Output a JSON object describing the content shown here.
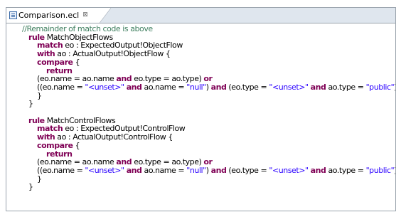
{
  "tab": {
    "label": "Comparison.ecl",
    "close_glyph": "⊠",
    "icon": "ecl-file-icon"
  },
  "colors": {
    "keyword": "#7f0055",
    "comment": "#3f7f5f",
    "string": "#2a00ff",
    "text": "#000000",
    "tab_strip": "#dfe6ee",
    "border": "#9aa3ad"
  },
  "code_lines": [
    [
      {
        "t": "comment",
        "v": "//Remainder of match code is above"
      }
    ],
    [
      {
        "t": "keyword",
        "v": "rule"
      },
      {
        "t": "plain",
        "v": " MatchObjectFlows"
      }
    ],
    [
      {
        "t": "keyword",
        "v": "match"
      },
      {
        "t": "plain",
        "v": " eo : ExpectedOutput!ObjectFlow"
      }
    ],
    [
      {
        "t": "keyword",
        "v": "with"
      },
      {
        "t": "plain",
        "v": " ao : ActualOutput!ObjectFlow {"
      }
    ],
    [
      {
        "t": "keyword",
        "v": "compare"
      },
      {
        "t": "plain",
        "v": " {"
      }
    ],
    [
      {
        "t": "keyword",
        "v": "return"
      }
    ],
    [
      {
        "t": "plain",
        "v": "(eo.name = ao.name "
      },
      {
        "t": "keyword",
        "v": "and"
      },
      {
        "t": "plain",
        "v": " eo.type = ao.type) "
      },
      {
        "t": "keyword",
        "v": "or"
      }
    ],
    [
      {
        "t": "plain",
        "v": "((eo.name = "
      },
      {
        "t": "string",
        "v": "\"<unset>\""
      },
      {
        "t": "plain",
        "v": " "
      },
      {
        "t": "keyword",
        "v": "and"
      },
      {
        "t": "plain",
        "v": " ao.name = "
      },
      {
        "t": "string",
        "v": "\"null\""
      },
      {
        "t": "plain",
        "v": ") "
      },
      {
        "t": "keyword",
        "v": "and"
      },
      {
        "t": "plain",
        "v": " (eo.type = "
      },
      {
        "t": "string",
        "v": "\"<unset>\""
      },
      {
        "t": "plain",
        "v": " "
      },
      {
        "t": "keyword",
        "v": "and"
      },
      {
        "t": "plain",
        "v": " ao.type = "
      },
      {
        "t": "string",
        "v": "\"public\""
      },
      {
        "t": "plain",
        "v": "));"
      }
    ],
    [
      {
        "t": "plain",
        "v": "}"
      }
    ],
    [
      {
        "t": "plain",
        "v": "}"
      }
    ],
    [],
    [
      {
        "t": "keyword",
        "v": "rule"
      },
      {
        "t": "plain",
        "v": " MatchControlFlows"
      }
    ],
    [
      {
        "t": "keyword",
        "v": "match"
      },
      {
        "t": "plain",
        "v": " eo : ExpectedOutput!ControlFlow"
      }
    ],
    [
      {
        "t": "keyword",
        "v": "with"
      },
      {
        "t": "plain",
        "v": " ao : ActualOutput!ControlFlow {"
      }
    ],
    [
      {
        "t": "keyword",
        "v": "compare"
      },
      {
        "t": "plain",
        "v": " {"
      }
    ],
    [
      {
        "t": "keyword",
        "v": "return"
      }
    ],
    [
      {
        "t": "plain",
        "v": "(eo.name = ao.name "
      },
      {
        "t": "keyword",
        "v": "and"
      },
      {
        "t": "plain",
        "v": " eo.type = ao.type) "
      },
      {
        "t": "keyword",
        "v": "or"
      }
    ],
    [
      {
        "t": "plain",
        "v": "((eo.name = "
      },
      {
        "t": "string",
        "v": "\"<unset>\""
      },
      {
        "t": "plain",
        "v": " "
      },
      {
        "t": "keyword",
        "v": "and"
      },
      {
        "t": "plain",
        "v": " ao.name = "
      },
      {
        "t": "string",
        "v": "\"null\""
      },
      {
        "t": "plain",
        "v": ") "
      },
      {
        "t": "keyword",
        "v": "and"
      },
      {
        "t": "plain",
        "v": " (eo.type = "
      },
      {
        "t": "string",
        "v": "\"<unset>\""
      },
      {
        "t": "plain",
        "v": " "
      },
      {
        "t": "keyword",
        "v": "and"
      },
      {
        "t": "plain",
        "v": " ao.type = "
      },
      {
        "t": "string",
        "v": "\"public\""
      },
      {
        "t": "plain",
        "v": "));"
      }
    ],
    [
      {
        "t": "plain",
        "v": "}"
      }
    ],
    [
      {
        "t": "plain",
        "v": "}"
      }
    ]
  ]
}
